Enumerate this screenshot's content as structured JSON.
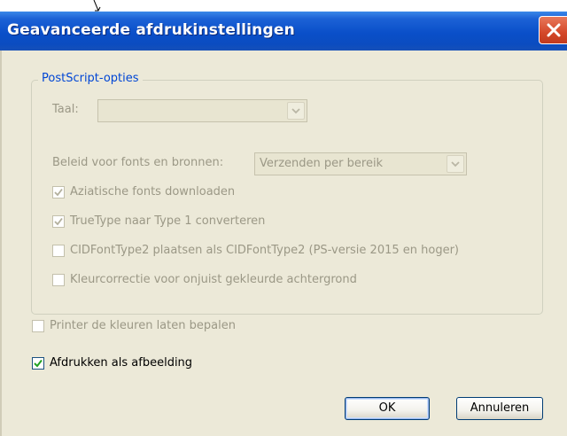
{
  "window": {
    "title": "Geavanceerde afdrukinstellingen",
    "title_bar_color": "#0a4fc9",
    "close_button_color": "#d4482a"
  },
  "postscript_group": {
    "legend": "PostScript-opties",
    "language": {
      "label": "Taal:",
      "value": "",
      "enabled": false
    },
    "font_policy": {
      "label": "Beleid voor fonts en bronnen:",
      "value": "Verzenden per bereik",
      "enabled": false
    },
    "options": [
      {
        "label": "Aziatische fonts downloaden",
        "checked": true,
        "enabled": false
      },
      {
        "label": "TrueType naar Type 1 converteren",
        "checked": true,
        "enabled": false
      },
      {
        "label": "CIDFontType2 plaatsen als CIDFontType2 (PS-versie 2015 en hoger)",
        "checked": false,
        "enabled": false
      },
      {
        "label": "Kleurcorrectie voor onjuist gekleurde achtergrond",
        "checked": false,
        "enabled": false
      }
    ]
  },
  "printer_colors": {
    "label": "Printer de kleuren laten bepalen",
    "checked": false,
    "enabled": false
  },
  "print_as_image": {
    "label": "Afdrukken als afbeelding",
    "checked": true,
    "enabled": true
  },
  "buttons": {
    "ok": "OK",
    "cancel": "Annuleren"
  },
  "icons": {
    "close": "close-icon",
    "dropdown": "chevron-down-icon",
    "check": "checkmark-icon"
  },
  "colors": {
    "legend": "#0046d5",
    "disabled_text": "#9b9886",
    "dialog_bg": "#ece9d8"
  }
}
